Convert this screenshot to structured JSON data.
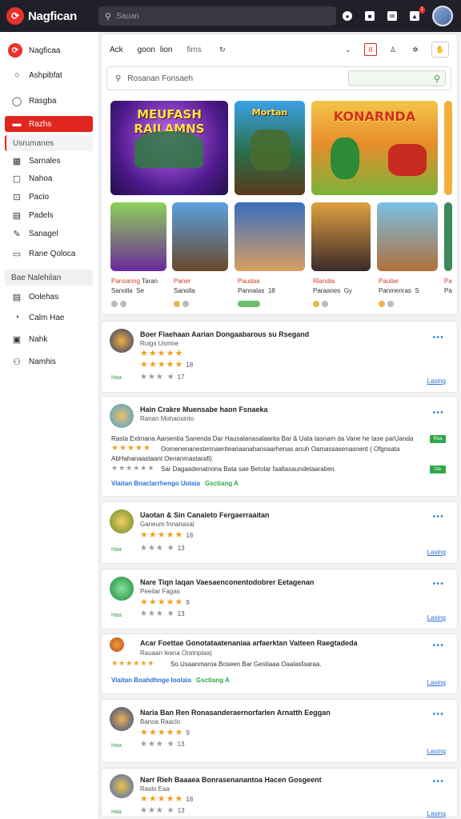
{
  "app": {
    "title": "Nagfican",
    "search_placeholder": "Sauan",
    "notif_count": "1"
  },
  "sidebar": {
    "brand": "Nagficaa",
    "items": [
      {
        "label": "Ashpibfat",
        "icon": "circle"
      },
      {
        "label": "Rasgba",
        "icon": "chat"
      },
      {
        "label": "Razhs",
        "icon": "folder"
      },
      {
        "label": "Usrumanes",
        "icon": ""
      },
      {
        "label": "Sarnales",
        "icon": "grid"
      },
      {
        "label": "Nahoa",
        "icon": "square"
      },
      {
        "label": "Pacio",
        "icon": "bookmark"
      },
      {
        "label": "Padels",
        "icon": "doc"
      },
      {
        "label": "Sanagel",
        "icon": "pen"
      },
      {
        "label": "Rane Qoloca",
        "icon": "box"
      },
      {
        "label": "Bae Nalehilan",
        "icon": ""
      },
      {
        "label": "Oolehas",
        "icon": "doc"
      },
      {
        "label": "Calm Hae",
        "icon": "clock"
      },
      {
        "label": "Nahk",
        "icon": "box"
      },
      {
        "label": "Namhis",
        "icon": "people"
      }
    ]
  },
  "filter": {
    "a": "Ack",
    "b": "goon",
    "c": "lion",
    "d": "fims",
    "search": "Rosanan Fonsaeh"
  },
  "tiles": [
    {
      "title": "MEUFASH RAILAMNS"
    },
    {
      "title": "Mortan"
    },
    {
      "title": "KONARNDA"
    }
  ],
  "games": [
    {
      "name": "Pansanng",
      "tag": "Taran",
      "sub": "Sanolla",
      "sub2": "Se"
    },
    {
      "name": "Paner",
      "tag": "",
      "sub": "Sanolla",
      "sub2": ""
    },
    {
      "name": "Paudaa",
      "tag": "",
      "sub": "Pannalas",
      "sub2": "18"
    },
    {
      "name": "Rlandia",
      "tag": "",
      "sub": "Paraanes",
      "sub2": "Gy"
    },
    {
      "name": "Paulae",
      "tag": "",
      "sub": "Panmenras",
      "sub2": "S"
    },
    {
      "name": "Pa",
      "tag": "",
      "sub": "Pa",
      "sub2": ""
    }
  ],
  "reviews": [
    {
      "title": "Boer Fiaehaan Aarian Dongaabarous su Rsegand",
      "sub": "Ruigs Usmne",
      "count": "18",
      "grey": "17",
      "tag": "Haa",
      "link": "Lasing"
    },
    {
      "title": "Hain Crakre Muensabe haon Fsnaeka",
      "sub": "Ranan Mohaosinto",
      "body1": "Rasta Extmana  Aarsentia Sanenda  Dar Hausalanasalaanta Bar & Uata tasnam da Vane he tase parUanda",
      "body2": "Oomenenanestennaeriteariaanahansaarhenas anuh Oamassasenasnent ( Ofgnsata",
      "body3": "AbHahanaastaant Oenanmastarafi)",
      "body4": "Sar Dagaadenatnona Bata sae Betolar faaltasaundetaaratien.",
      "tag1": "Rsa",
      "tag2": "Ua",
      "link1": "Viaitan Bnaclarrhengo",
      "link2": "Uolaia",
      "link3": "Gsctiang A"
    },
    {
      "title": "Uaotan & Sin Canaleto Fergaerraaitan",
      "sub": "Ganeum fnnanasal",
      "count": "18",
      "grey": "13",
      "tag": "Haa",
      "link": "Lasing"
    },
    {
      "title": "Nare Tiqn laqan Vaesaenconentodobrer Eetagenan",
      "sub": "Peeitar Fagas",
      "count": "9",
      "grey": "13",
      "tag": "Haa",
      "link": "Lasing"
    },
    {
      "title": "Acar Foettae Gonotataatenaniaa arfaerktan Vaiteen Raegtadeda",
      "sub": "Rauaan leana Oratnpiaa)",
      "body": "So Usaanmaroa Boseen Bar Gestiaaa Oaalasfaaraa.",
      "link1": "Viaitan Boahdhnge",
      "link2": "Ioolaia",
      "link3": "Gsctiang A",
      "link": "Lasing"
    },
    {
      "title": "Naria Ban Ren Ronasanderaernorfarlen Arnatth Eeggan",
      "sub": "Banoa Raaclo",
      "count": "9",
      "grey": "13",
      "tag": "Haa",
      "link": "Lasing"
    },
    {
      "title": "Narr Rieh Baaaea Bonrasenanantoa Hacen Gosgeent",
      "sub": "Raslo Eaa",
      "count": "18",
      "grey": "13",
      "tag": "Haa",
      "link": "Lasing"
    }
  ],
  "icon_names": [
    "logo-icon",
    "search-icon",
    "globe-icon",
    "chat-icon",
    "mail-icon",
    "bell-icon"
  ],
  "colors": {
    "brand": "#e0261f",
    "topbar": "#20202a",
    "star": "#f0a020",
    "link": "#2a6fd6"
  }
}
